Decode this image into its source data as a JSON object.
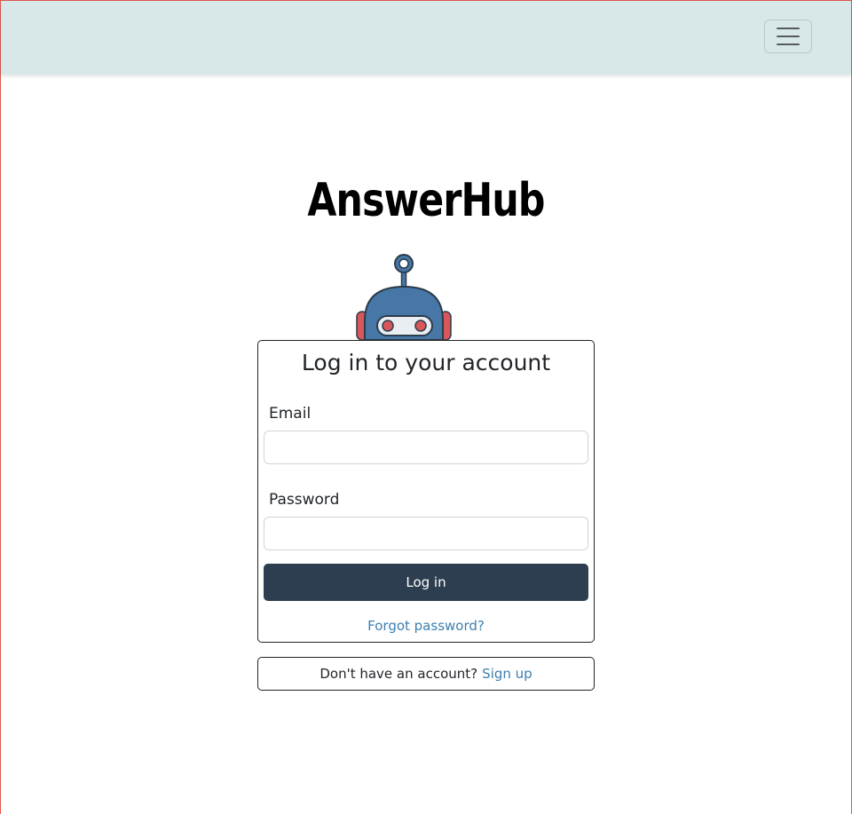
{
  "navbar": {
    "toggle_icon": "hamburger-menu-icon",
    "background": "#d8e8e8"
  },
  "brand": {
    "title": "AnswerHub",
    "logo_icon": "robot-mascot-icon"
  },
  "login_form": {
    "title": "Log in to your account",
    "email_label": "Email",
    "email_value": "",
    "password_label": "Password",
    "password_value": "",
    "submit_label": "Log in",
    "forgot_label": "Forgot password?",
    "button_color": "#2c3e50",
    "link_color": "#3d7fae"
  },
  "signup": {
    "prompt": "Don't have an account?",
    "link_label": "Sign up"
  }
}
